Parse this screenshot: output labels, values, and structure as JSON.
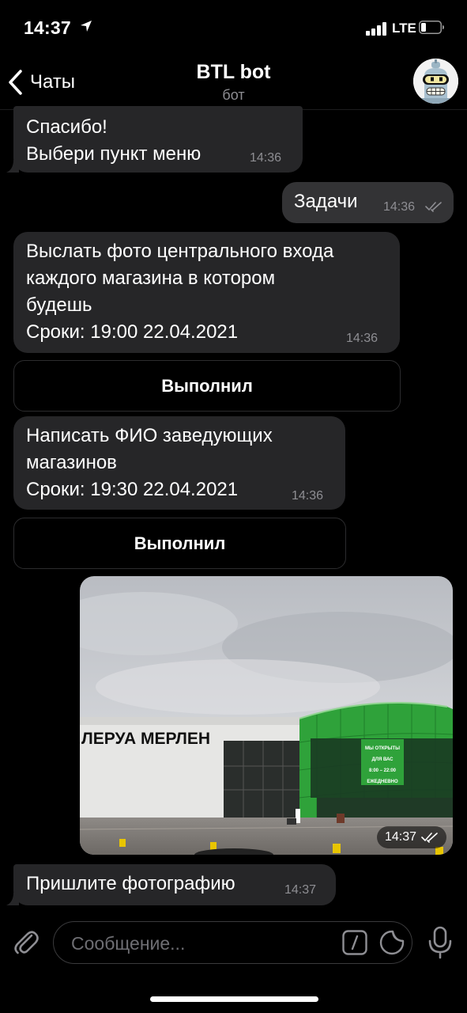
{
  "status_bar": {
    "time": "14:37",
    "network": "LTE"
  },
  "header": {
    "back_label": "Чаты",
    "title": "BTL bot",
    "subtitle": "бот"
  },
  "messages": [
    {
      "direction": "in",
      "text": "Спасибо!\nВыбери пункт меню",
      "time": "14:36"
    },
    {
      "direction": "out",
      "text": "Задачи",
      "time": "14:36",
      "read": true
    },
    {
      "direction": "in",
      "text": "Выслать фото центрального входа\nкаждого магазина в котором\nбудешь\nСроки: 19:00 22.04.2021",
      "time": "14:36",
      "button": "Выполнил"
    },
    {
      "direction": "in",
      "text": "Написать ФИО заведующих\nмагазинов\nСроки: 19:30 22.04.2021",
      "time": "14:36",
      "button": "Выполнил"
    },
    {
      "direction": "out",
      "type": "photo",
      "time": "14:37",
      "read": true,
      "photo_text": {
        "store_sign": "ЛЕРУА МЕРЛЕН",
        "banner_lines": [
          "МЫ ОТКРЫТЫ",
          "ДЛЯ ВАС",
          "8:00 – 22:00",
          "ЕЖЕДНЕВНО"
        ]
      }
    },
    {
      "direction": "in",
      "text": "Пришлите фотографию",
      "time": "14:37"
    }
  ],
  "input": {
    "placeholder": "Сообщение..."
  },
  "icons": {
    "back": "chevron-left-icon",
    "attach": "paperclip-icon",
    "commands": "slash-command-icon",
    "sticker": "sticker-icon",
    "mic": "microphone-icon",
    "read_receipt": "double-check-icon"
  },
  "colors": {
    "background": "#000000",
    "incoming_bubble": "#262628",
    "outgoing_bubble": "#333335",
    "secondary_text": "#8e8e93"
  }
}
